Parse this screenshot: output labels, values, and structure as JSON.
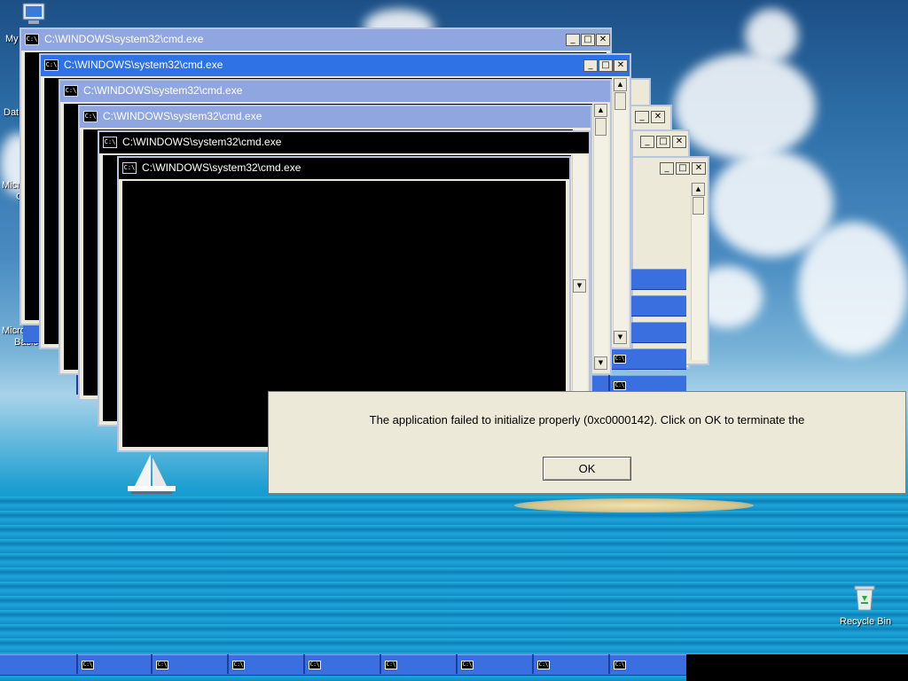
{
  "desktop": {
    "icons": [
      {
        "label": "My",
        "icon": "my-computer-icon"
      },
      {
        "label": "Dat",
        "icon": "document-icon"
      },
      {
        "label": "Micro",
        "icon": "program-icon"
      },
      {
        "label": "C",
        "icon": "program-icon"
      },
      {
        "label": "Microsoft",
        "icon": "program-icon"
      },
      {
        "label": "Basic",
        "icon": "program-icon"
      }
    ],
    "recycle_bin": {
      "label": "Recycle Bin",
      "icon": "recycle-bin-icon"
    }
  },
  "windows": [
    {
      "title": "C:\\WINDOWS\\system32\\cmd.exe",
      "icon_text": "C:\\",
      "active": false
    },
    {
      "title": "C:\\WINDOWS\\system32\\cmd.exe",
      "icon_text": "C:\\",
      "active": true
    },
    {
      "title": "C:\\WINDOWS\\system32\\cmd.exe",
      "icon_text": "C:\\",
      "active": false
    },
    {
      "title": "C:\\WINDOWS\\system32\\cmd.exe",
      "icon_text": "C:\\",
      "active": false
    },
    {
      "title": "C:\\WINDOWS\\system32\\cmd.exe",
      "icon_text": "C:\\",
      "active": false
    },
    {
      "title": "C:\\WINDOWS\\system32\\cmd.exe",
      "icon_text": "C:\\",
      "active": false
    }
  ],
  "window_buttons": {
    "minimize": "_",
    "maximize": "□",
    "close": "✕"
  },
  "taskbar_band_icon": "C:\\",
  "dialog": {
    "message": "The application failed to initialize properly (0xc0000142). Click on OK to terminate the",
    "ok_label": "OK"
  },
  "colors": {
    "active_title": "#2f72e6",
    "inactive_title": "#8fa6e0",
    "dialog_bg": "#ece9d8",
    "console_bg": "#000000",
    "band": "#3a6fe0"
  }
}
